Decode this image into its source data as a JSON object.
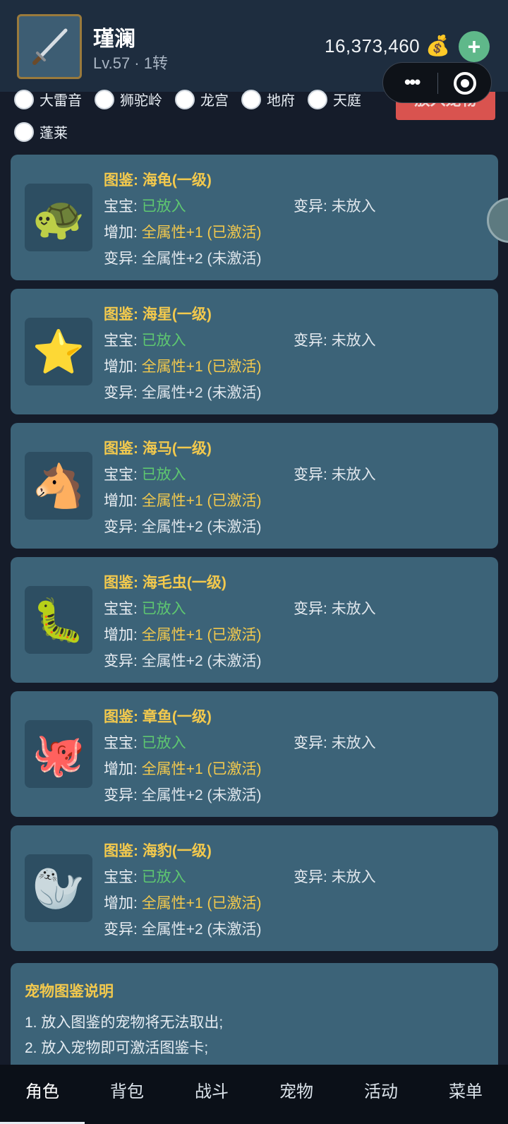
{
  "header": {
    "player_name": "瑾澜",
    "player_level": "Lv.57 · 1转",
    "gold": "16,373,460",
    "gold_icon": "money-bag-icon",
    "plus_label": "+"
  },
  "filter": {
    "put_button_label": "放入宠物",
    "options": [
      "大雷音",
      "狮驼岭",
      "龙宫",
      "地府",
      "天庭",
      "蓬莱"
    ]
  },
  "labels": {
    "baby": "宝宝:",
    "mutation": "变异:",
    "add": "增加:",
    "mutation_bonus": "变异:"
  },
  "cards": [
    {
      "title": "图鉴: 海龟(一级)",
      "emoji": "🐢",
      "baby_status": "已放入",
      "mutation_status": "未放入",
      "add_bonus": "全属性+1 (已激活)",
      "mutation_bonus": "全属性+2 (未激活)"
    },
    {
      "title": "图鉴: 海星(一级)",
      "emoji": "⭐",
      "baby_status": "已放入",
      "mutation_status": "未放入",
      "add_bonus": "全属性+1 (已激活)",
      "mutation_bonus": "全属性+2 (未激活)"
    },
    {
      "title": "图鉴: 海马(一级)",
      "emoji": "🐴",
      "baby_status": "已放入",
      "mutation_status": "未放入",
      "add_bonus": "全属性+1 (已激活)",
      "mutation_bonus": "全属性+2 (未激活)"
    },
    {
      "title": "图鉴: 海毛虫(一级)",
      "emoji": "🐛",
      "baby_status": "已放入",
      "mutation_status": "未放入",
      "add_bonus": "全属性+1 (已激活)",
      "mutation_bonus": "全属性+2 (未激活)"
    },
    {
      "title": "图鉴: 章鱼(一级)",
      "emoji": "🐙",
      "baby_status": "已放入",
      "mutation_status": "未放入",
      "add_bonus": "全属性+1 (已激活)",
      "mutation_bonus": "全属性+2 (未激活)"
    },
    {
      "title": "图鉴: 海豹(一级)",
      "emoji": "🦭",
      "baby_status": "已放入",
      "mutation_status": "未放入",
      "add_bonus": "全属性+1 (已激活)",
      "mutation_bonus": "全属性+2 (未激活)"
    }
  ],
  "info": {
    "title": "宠物图鉴说明",
    "lines": [
      "1. 放入图鉴的宠物将无法取出;",
      "2. 放入宠物即可激活图鉴卡;"
    ]
  },
  "nav": [
    "角色",
    "背包",
    "战斗",
    "宠物",
    "活动",
    "菜单"
  ],
  "colors": {
    "accent_yellow": "#f3c94d",
    "active_green": "#5ec770",
    "put_button_red": "#d9534f",
    "card_bg": "#3c6378"
  }
}
